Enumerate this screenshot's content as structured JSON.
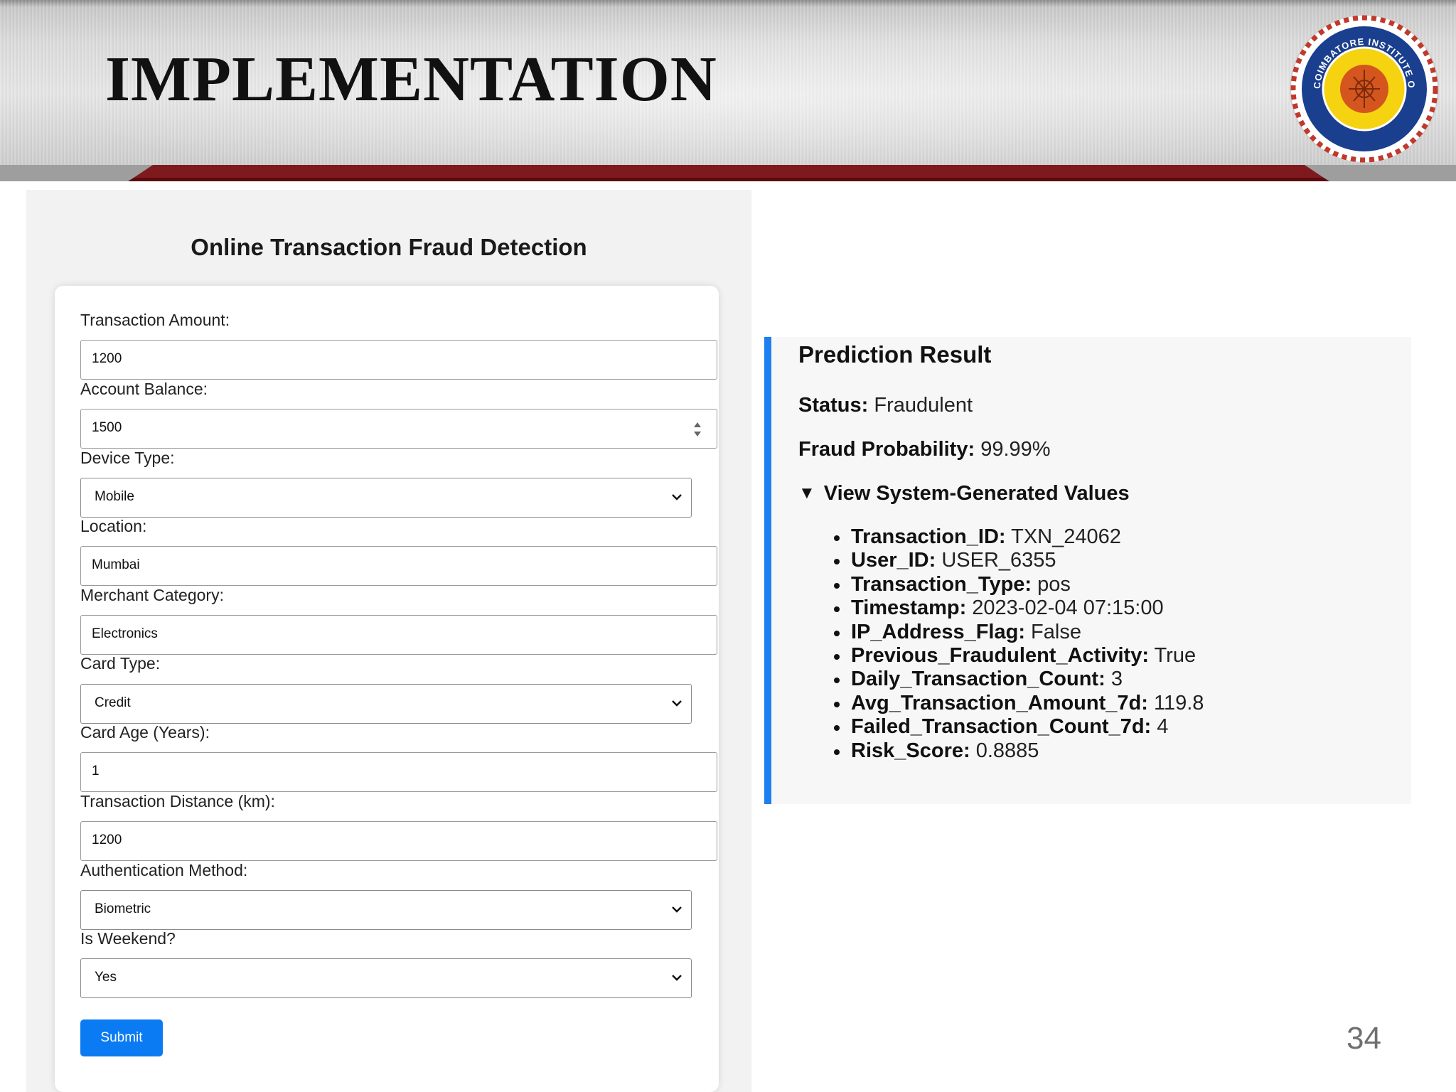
{
  "slide": {
    "title": "IMPLEMENTATION",
    "page_number": "34",
    "logo": {
      "icon": "institute-seal",
      "text": "COIMBATORE INSTITUTE OF TECHNOLOGY"
    },
    "colors": {
      "band_red": "#7e1a1e",
      "band_dark": "#5a0c10"
    }
  },
  "app": {
    "title": "Online Transaction Fraud Detection",
    "submit_label": "Submit",
    "accent": "#0a7bf2",
    "fields": [
      {
        "label": "Transaction Amount:",
        "value": "1200",
        "kind": "text"
      },
      {
        "label": "Account Balance:",
        "value": "1500",
        "kind": "number"
      },
      {
        "label": "Device Type:",
        "value": "Mobile",
        "kind": "select"
      },
      {
        "label": "Location:",
        "value": "Mumbai",
        "kind": "text"
      },
      {
        "label": "Merchant Category:",
        "value": "Electronics",
        "kind": "text"
      },
      {
        "label": "Card Type:",
        "value": "Credit",
        "kind": "select"
      },
      {
        "label": "Card Age (Years):",
        "value": "1",
        "kind": "text"
      },
      {
        "label": "Transaction Distance (km):",
        "value": "1200",
        "kind": "text"
      },
      {
        "label": "Authentication Method:",
        "value": "Biometric",
        "kind": "select"
      },
      {
        "label": "Is Weekend?",
        "value": "Yes",
        "kind": "select"
      }
    ]
  },
  "result": {
    "heading": "Prediction Result",
    "status_label": "Status:",
    "status_value": "Fraudulent",
    "probability_label": "Fraud Probability:",
    "probability_value": "99.99%",
    "details_summary": "View System-Generated Values",
    "details_icon": "triangle-down-icon",
    "border_color": "#1e7ff0",
    "values": [
      {
        "key": "Transaction_ID:",
        "value": "TXN_24062"
      },
      {
        "key": "User_ID:",
        "value": "USER_6355"
      },
      {
        "key": "Transaction_Type:",
        "value": "pos"
      },
      {
        "key": "Timestamp:",
        "value": "2023-02-04 07:15:00"
      },
      {
        "key": "IP_Address_Flag:",
        "value": "False"
      },
      {
        "key": "Previous_Fraudulent_Activity:",
        "value": "True"
      },
      {
        "key": "Daily_Transaction_Count:",
        "value": "3"
      },
      {
        "key": "Avg_Transaction_Amount_7d:",
        "value": "119.8"
      },
      {
        "key": "Failed_Transaction_Count_7d:",
        "value": "4"
      },
      {
        "key": "Risk_Score:",
        "value": "0.8885"
      }
    ]
  }
}
